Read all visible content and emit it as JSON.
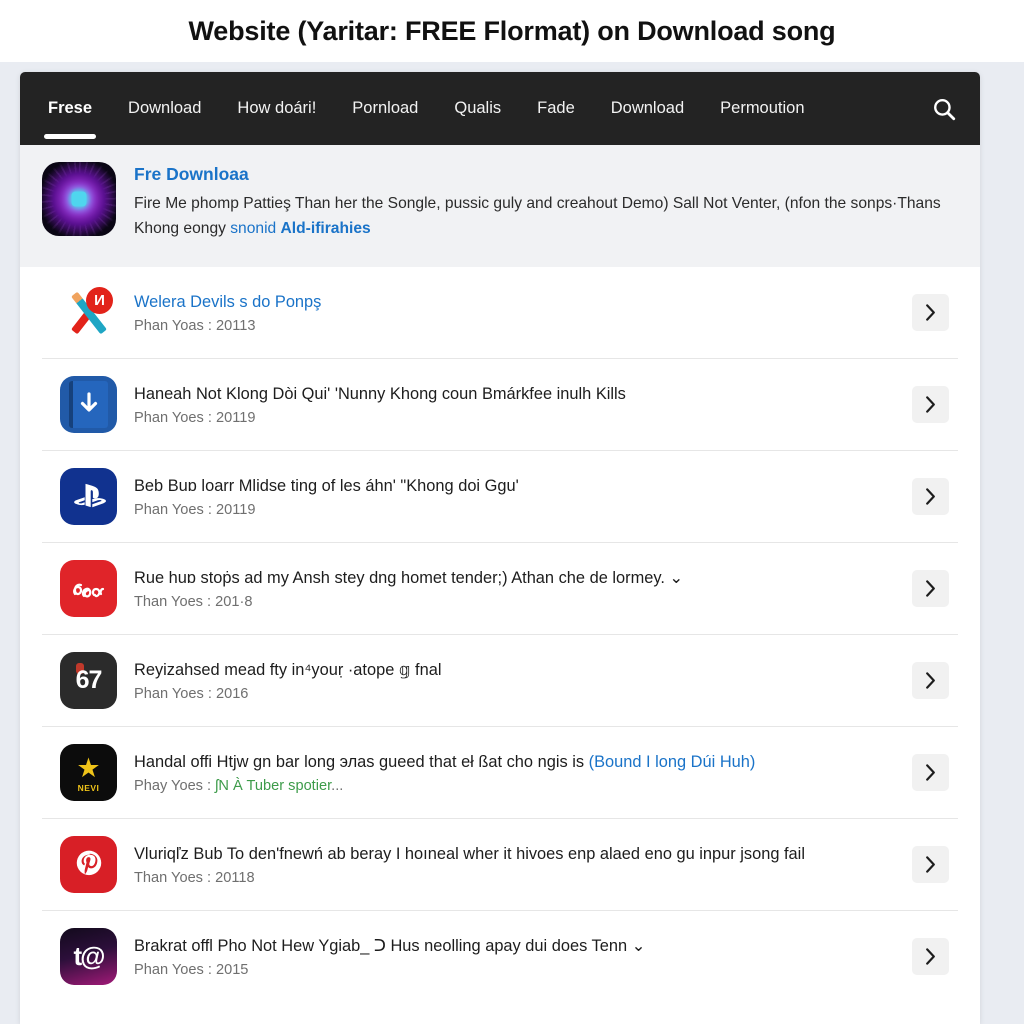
{
  "page": {
    "heading": "Website (Yaritar: FREE Flormat) on Download song"
  },
  "nav": {
    "items": [
      {
        "label": "Frese",
        "active": true
      },
      {
        "label": "Download",
        "active": false
      },
      {
        "label": "How doári!",
        "active": false
      },
      {
        "label": "Pornload",
        "active": false
      },
      {
        "label": "Qualis",
        "active": false
      },
      {
        "label": "Fade",
        "active": false
      },
      {
        "label": "Download",
        "active": false
      },
      {
        "label": "Permoution",
        "active": false
      }
    ],
    "search_icon": "search-icon",
    "background_color": "#232323"
  },
  "featured": {
    "icon": "starburst-app-icon",
    "title": "Fre Downloaa",
    "desc_part1": "Fire Me phomp Pattieş Than her the Songle, pussic guly and creahout Demo) Sall Not Venter, (nfon the sonps·Thans Khong eongy ",
    "desc_link": "snonid ",
    "desc_link_bold": "Ald-ifirahies",
    "link_color": "#1a73c8",
    "background_color": "#f1f2f4"
  },
  "results": {
    "caret_icon": "chevron-right-icon",
    "rows": [
      {
        "icon": "crossed-pencils-icon",
        "icon_badge": "И",
        "title": "Welera Devils s do Ponpş",
        "title_is_link": true,
        "subtitle": "Phan Yoas : 20113"
      },
      {
        "icon": "download-document-icon",
        "title": "Haneah Not Klong Dòi Qui' 'Nunny Khong coun Bmárkfee inulh Kills",
        "title_is_link": false,
        "subtitle": "Phan Yoes : 20119"
      },
      {
        "icon": "playstation-icon",
        "title": "Beb Buɒ loarr Mlidse ting of les áhn' \"Khong doi Ggu'",
        "title_is_link": false,
        "subtitle": "Phan Yoes : 20119"
      },
      {
        "icon": "red-scribble-icon",
        "title": "Rue huɒ stoṗs ad my Ansh stey dng homet tender;) Athan che de lormey.  ⌄",
        "title_is_link": false,
        "subtitle": "Than Yoes : 201·8"
      },
      {
        "icon": "sixty-seven-icon",
        "icon_label": "67",
        "title": "Reyizahsed mead fty in⁴youṛ ·atope 𝕘 fnal",
        "title_is_link": false,
        "subtitle": "Phan Yoes : 2016"
      },
      {
        "icon": "gold-star-icon",
        "icon_label": "NEVI",
        "title_before": "Handal offi Htjw gn bar long элаs gueed that eł ßat cho ngis is ",
        "title_link": "(Bound I long Dúi Huh)",
        "title_is_link": false,
        "subtitle_before": "Phay Yoes : ",
        "subtitle_green": "ʃN À Tuber spotier",
        "subtitle_after": "..."
      },
      {
        "icon": "pinterest-icon",
        "title": "Vluriqľz Bub To den'fnewń ab beray I hoıneal wher it hivoes enp alaed eno gu inpur jsong fail",
        "title_is_link": false,
        "subtitle": "Than Yoes : 20118"
      },
      {
        "icon": "t-at-gradient-icon",
        "icon_label": "t@",
        "title": "Brakrat offl Pho Not Hew Ygiab_ ᑐ Hus neolling apay dui does Tenn  ⌄",
        "title_is_link": false,
        "subtitle": "Phan Yoes : 2015"
      }
    ]
  }
}
